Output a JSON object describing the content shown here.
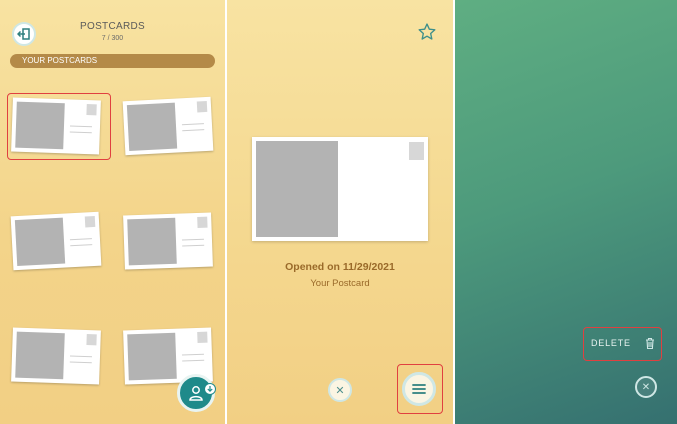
{
  "panel1": {
    "title": "POSTCARDS",
    "count": "7 / 300",
    "section_label": "YOUR POSTCARDS"
  },
  "panel2": {
    "opened_text": "Opened on 11/29/2021",
    "subtitle": "Your Postcard"
  },
  "panel3": {
    "delete_label": "DELETE"
  },
  "icons": {
    "back": "exit-door-icon",
    "user_fab": "user-icon",
    "badge": "download-arrow-icon",
    "star": "star-outline-icon",
    "close": "close-icon",
    "menu": "hamburger-icon",
    "trash": "trash-icon"
  },
  "colors": {
    "highlight": "#e04040",
    "section_bar": "#b48a48",
    "teal": "#1f8a8a",
    "text_brown": "#9a6a2a"
  }
}
